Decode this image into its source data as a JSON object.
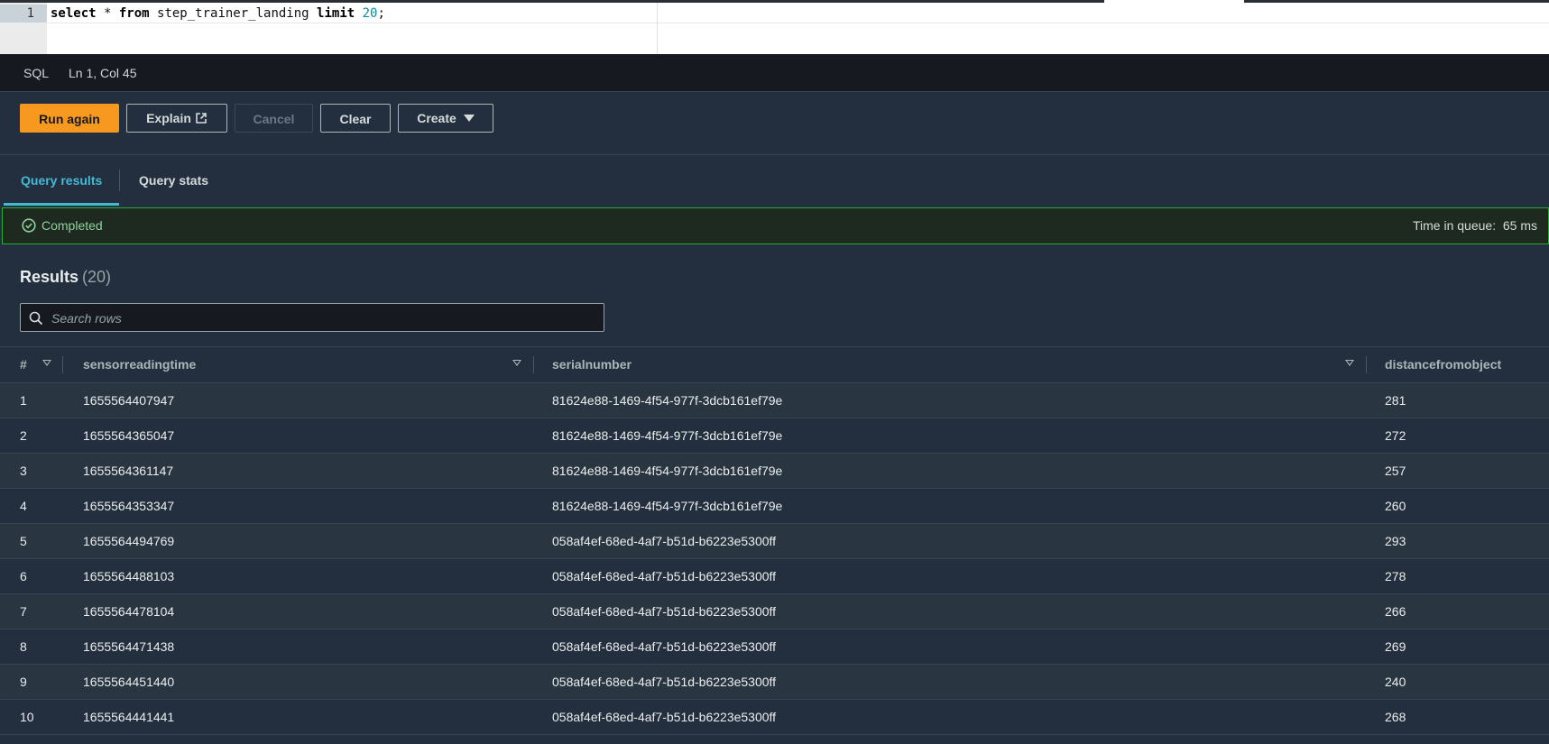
{
  "editor": {
    "line_number": "1",
    "query": {
      "kw1": "select",
      "star": " * ",
      "kw2": "from",
      "table": " step_trainer_landing ",
      "kw3": "limit",
      "space": " ",
      "limit_value": "20",
      "end": ";"
    }
  },
  "statusbar": {
    "language": "SQL",
    "cursor": "Ln 1, Col 45"
  },
  "toolbar": {
    "run_again": "Run again",
    "explain": "Explain",
    "cancel": "Cancel",
    "clear": "Clear",
    "create": "Create"
  },
  "tabs": [
    {
      "label": "Query results",
      "active": true
    },
    {
      "label": "Query stats",
      "active": false
    }
  ],
  "status": {
    "state": "Completed",
    "queue_label": "Time in queue:",
    "queue_value": "65 ms"
  },
  "results": {
    "title": "Results",
    "count": "(20)",
    "search_placeholder": "Search rows",
    "columns": [
      "#",
      "sensorreadingtime",
      "serialnumber",
      "distancefromobject"
    ],
    "rows": [
      [
        "1",
        "1655564407947",
        "81624e88-1469-4f54-977f-3dcb161ef79e",
        "281"
      ],
      [
        "2",
        "1655564365047",
        "81624e88-1469-4f54-977f-3dcb161ef79e",
        "272"
      ],
      [
        "3",
        "1655564361147",
        "81624e88-1469-4f54-977f-3dcb161ef79e",
        "257"
      ],
      [
        "4",
        "1655564353347",
        "81624e88-1469-4f54-977f-3dcb161ef79e",
        "260"
      ],
      [
        "5",
        "1655564494769",
        "058af4ef-68ed-4af7-b51d-b6223e5300ff",
        "293"
      ],
      [
        "6",
        "1655564488103",
        "058af4ef-68ed-4af7-b51d-b6223e5300ff",
        "278"
      ],
      [
        "7",
        "1655564478104",
        "058af4ef-68ed-4af7-b51d-b6223e5300ff",
        "266"
      ],
      [
        "8",
        "1655564471438",
        "058af4ef-68ed-4af7-b51d-b6223e5300ff",
        "269"
      ],
      [
        "9",
        "1655564451440",
        "058af4ef-68ed-4af7-b51d-b6223e5300ff",
        "240"
      ],
      [
        "10",
        "1655564441441",
        "058af4ef-68ed-4af7-b51d-b6223e5300ff",
        "268"
      ]
    ]
  },
  "colors": {
    "primary_button": "#f7981f",
    "active_tab": "#44b9d6",
    "success": "#29ad32"
  }
}
